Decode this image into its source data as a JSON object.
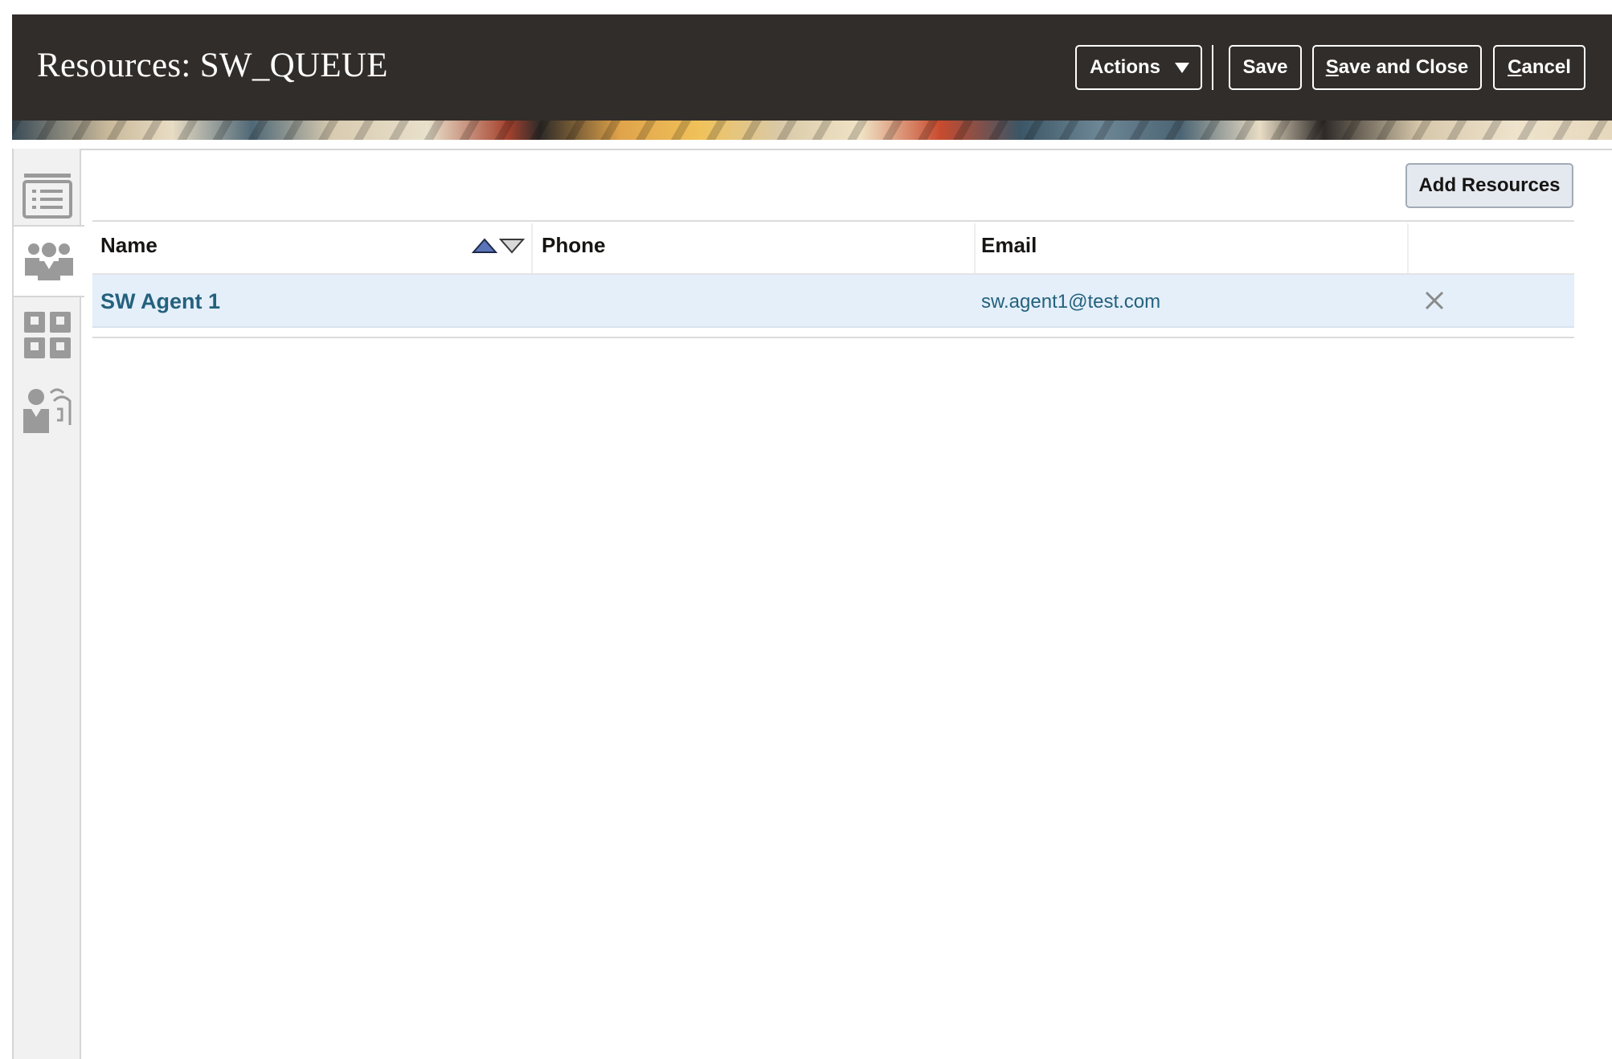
{
  "header": {
    "title": "Resources: SW_QUEUE",
    "actions_label": "Actions",
    "save_label": "Save",
    "save_close_label_underlined": "S",
    "save_close_label_rest": "ave and Close",
    "cancel_label_underlined": "C",
    "cancel_label_rest": "ancel"
  },
  "sidebar": {
    "tabs": [
      {
        "icon": "list-details-icon",
        "active": false
      },
      {
        "icon": "team-people-icon",
        "active": true
      },
      {
        "icon": "grid-apps-icon",
        "active": false
      },
      {
        "icon": "user-communication-icon",
        "active": false
      }
    ]
  },
  "main": {
    "add_button_label": "Add Resources",
    "columns": [
      "Name",
      "Phone",
      "Email"
    ],
    "rows": [
      {
        "name": "SW Agent 1",
        "phone": "",
        "email": "sw.agent1@test.com"
      }
    ]
  },
  "colors": {
    "header_bg": "#312d2a",
    "link": "#24617d",
    "row_selected": "#e4effa",
    "rail_bg": "#f1f1f1"
  }
}
